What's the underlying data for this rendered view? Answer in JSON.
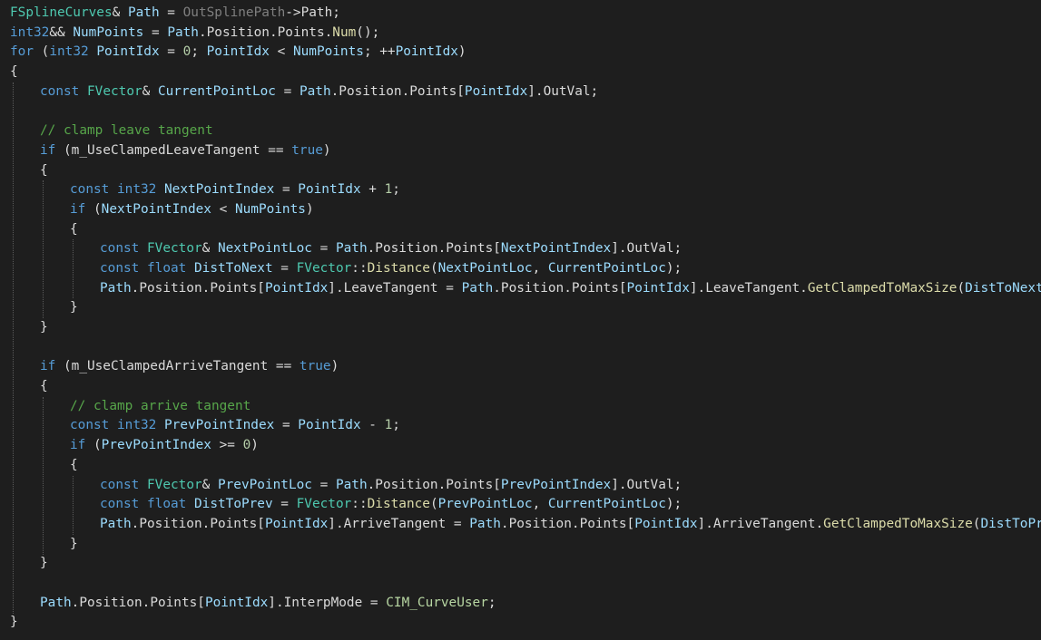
{
  "editor": {
    "colors": {
      "background": "#1e1e1e",
      "default": "#dcdcdc",
      "keyword": "#569cd6",
      "type": "#4ec9b0",
      "identifier": "#9cdcfe",
      "function": "#dcdcaa",
      "number": "#b5cea8",
      "comment": "#57a64a",
      "enum": "#b8d7a3",
      "param": "#7f7f7f"
    },
    "lines": [
      {
        "indent": 0,
        "tokens": [
          [
            "type",
            "FSplineCurves"
          ],
          [
            "default",
            "& "
          ],
          [
            "ident",
            "Path"
          ],
          [
            "default",
            " = "
          ],
          [
            "param",
            "OutSplinePath"
          ],
          [
            "default",
            "->"
          ],
          [
            "member",
            "Path"
          ],
          [
            "default",
            ";"
          ]
        ]
      },
      {
        "indent": 0,
        "tokens": [
          [
            "keyword",
            "int32"
          ],
          [
            "default",
            "&& "
          ],
          [
            "ident",
            "NumPoints"
          ],
          [
            "default",
            " = "
          ],
          [
            "ident",
            "Path"
          ],
          [
            "default",
            "."
          ],
          [
            "member",
            "Position"
          ],
          [
            "default",
            "."
          ],
          [
            "member",
            "Points"
          ],
          [
            "default",
            "."
          ],
          [
            "func",
            "Num"
          ],
          [
            "default",
            "();"
          ]
        ]
      },
      {
        "indent": 0,
        "tokens": [
          [
            "keyword",
            "for"
          ],
          [
            "default",
            " ("
          ],
          [
            "keyword",
            "int32"
          ],
          [
            "default",
            " "
          ],
          [
            "ident",
            "PointIdx"
          ],
          [
            "default",
            " = "
          ],
          [
            "number",
            "0"
          ],
          [
            "default",
            "; "
          ],
          [
            "ident",
            "PointIdx"
          ],
          [
            "default",
            " < "
          ],
          [
            "ident",
            "NumPoints"
          ],
          [
            "default",
            "; ++"
          ],
          [
            "ident",
            "PointIdx"
          ],
          [
            "default",
            ")"
          ]
        ]
      },
      {
        "indent": 0,
        "tokens": [
          [
            "default",
            "{"
          ]
        ]
      },
      {
        "indent": 1,
        "tokens": [
          [
            "keyword",
            "const"
          ],
          [
            "default",
            " "
          ],
          [
            "type",
            "FVector"
          ],
          [
            "default",
            "& "
          ],
          [
            "ident",
            "CurrentPointLoc"
          ],
          [
            "default",
            " = "
          ],
          [
            "ident",
            "Path"
          ],
          [
            "default",
            "."
          ],
          [
            "member",
            "Position"
          ],
          [
            "default",
            "."
          ],
          [
            "member",
            "Points"
          ],
          [
            "default",
            "["
          ],
          [
            "ident",
            "PointIdx"
          ],
          [
            "default",
            "]."
          ],
          [
            "member",
            "OutVal"
          ],
          [
            "default",
            ";"
          ]
        ]
      },
      {
        "indent": 1,
        "tokens": []
      },
      {
        "indent": 1,
        "tokens": [
          [
            "comment",
            "// clamp leave tangent"
          ]
        ]
      },
      {
        "indent": 1,
        "tokens": [
          [
            "keyword",
            "if"
          ],
          [
            "default",
            " ("
          ],
          [
            "member",
            "m_UseClampedLeaveTangent"
          ],
          [
            "default",
            " == "
          ],
          [
            "keyword",
            "true"
          ],
          [
            "default",
            ")"
          ]
        ]
      },
      {
        "indent": 1,
        "tokens": [
          [
            "default",
            "{"
          ]
        ]
      },
      {
        "indent": 2,
        "tokens": [
          [
            "keyword",
            "const"
          ],
          [
            "default",
            " "
          ],
          [
            "keyword",
            "int32"
          ],
          [
            "default",
            " "
          ],
          [
            "ident",
            "NextPointIndex"
          ],
          [
            "default",
            " = "
          ],
          [
            "ident",
            "PointIdx"
          ],
          [
            "default",
            " + "
          ],
          [
            "number",
            "1"
          ],
          [
            "default",
            ";"
          ]
        ]
      },
      {
        "indent": 2,
        "tokens": [
          [
            "keyword",
            "if"
          ],
          [
            "default",
            " ("
          ],
          [
            "ident",
            "NextPointIndex"
          ],
          [
            "default",
            " < "
          ],
          [
            "ident",
            "NumPoints"
          ],
          [
            "default",
            ")"
          ]
        ]
      },
      {
        "indent": 2,
        "tokens": [
          [
            "default",
            "{"
          ]
        ]
      },
      {
        "indent": 3,
        "tokens": [
          [
            "keyword",
            "const"
          ],
          [
            "default",
            " "
          ],
          [
            "type",
            "FVector"
          ],
          [
            "default",
            "& "
          ],
          [
            "ident",
            "NextPointLoc"
          ],
          [
            "default",
            " = "
          ],
          [
            "ident",
            "Path"
          ],
          [
            "default",
            "."
          ],
          [
            "member",
            "Position"
          ],
          [
            "default",
            "."
          ],
          [
            "member",
            "Points"
          ],
          [
            "default",
            "["
          ],
          [
            "ident",
            "NextPointIndex"
          ],
          [
            "default",
            "]."
          ],
          [
            "member",
            "OutVal"
          ],
          [
            "default",
            ";"
          ]
        ]
      },
      {
        "indent": 3,
        "tokens": [
          [
            "keyword",
            "const"
          ],
          [
            "default",
            " "
          ],
          [
            "keyword",
            "float"
          ],
          [
            "default",
            " "
          ],
          [
            "ident",
            "DistToNext"
          ],
          [
            "default",
            " = "
          ],
          [
            "type",
            "FVector"
          ],
          [
            "default",
            "::"
          ],
          [
            "func",
            "Distance"
          ],
          [
            "default",
            "("
          ],
          [
            "ident",
            "NextPointLoc"
          ],
          [
            "default",
            ", "
          ],
          [
            "ident",
            "CurrentPointLoc"
          ],
          [
            "default",
            ");"
          ]
        ]
      },
      {
        "indent": 3,
        "tokens": [
          [
            "ident",
            "Path"
          ],
          [
            "default",
            "."
          ],
          [
            "member",
            "Position"
          ],
          [
            "default",
            "."
          ],
          [
            "member",
            "Points"
          ],
          [
            "default",
            "["
          ],
          [
            "ident",
            "PointIdx"
          ],
          [
            "default",
            "]."
          ],
          [
            "member",
            "LeaveTangent"
          ],
          [
            "default",
            " = "
          ],
          [
            "ident",
            "Path"
          ],
          [
            "default",
            "."
          ],
          [
            "member",
            "Position"
          ],
          [
            "default",
            "."
          ],
          [
            "member",
            "Points"
          ],
          [
            "default",
            "["
          ],
          [
            "ident",
            "PointIdx"
          ],
          [
            "default",
            "]."
          ],
          [
            "member",
            "LeaveTangent"
          ],
          [
            "default",
            "."
          ],
          [
            "func",
            "GetClampedToMaxSize"
          ],
          [
            "default",
            "("
          ],
          [
            "ident",
            "DistToNext"
          ],
          [
            "default",
            ");"
          ]
        ]
      },
      {
        "indent": 2,
        "tokens": [
          [
            "default",
            "}"
          ]
        ]
      },
      {
        "indent": 1,
        "tokens": [
          [
            "default",
            "}"
          ]
        ]
      },
      {
        "indent": 1,
        "tokens": []
      },
      {
        "indent": 1,
        "tokens": [
          [
            "keyword",
            "if"
          ],
          [
            "default",
            " ("
          ],
          [
            "member",
            "m_UseClampedArriveTangent"
          ],
          [
            "default",
            " == "
          ],
          [
            "keyword",
            "true"
          ],
          [
            "default",
            ")"
          ]
        ]
      },
      {
        "indent": 1,
        "tokens": [
          [
            "default",
            "{"
          ]
        ]
      },
      {
        "indent": 2,
        "tokens": [
          [
            "comment",
            "// clamp arrive tangent"
          ]
        ]
      },
      {
        "indent": 2,
        "tokens": [
          [
            "keyword",
            "const"
          ],
          [
            "default",
            " "
          ],
          [
            "keyword",
            "int32"
          ],
          [
            "default",
            " "
          ],
          [
            "ident",
            "PrevPointIndex"
          ],
          [
            "default",
            " = "
          ],
          [
            "ident",
            "PointIdx"
          ],
          [
            "default",
            " - "
          ],
          [
            "number",
            "1"
          ],
          [
            "default",
            ";"
          ]
        ]
      },
      {
        "indent": 2,
        "tokens": [
          [
            "keyword",
            "if"
          ],
          [
            "default",
            " ("
          ],
          [
            "ident",
            "PrevPointIndex"
          ],
          [
            "default",
            " >= "
          ],
          [
            "number",
            "0"
          ],
          [
            "default",
            ")"
          ]
        ]
      },
      {
        "indent": 2,
        "tokens": [
          [
            "default",
            "{"
          ]
        ]
      },
      {
        "indent": 3,
        "tokens": [
          [
            "keyword",
            "const"
          ],
          [
            "default",
            " "
          ],
          [
            "type",
            "FVector"
          ],
          [
            "default",
            "& "
          ],
          [
            "ident",
            "PrevPointLoc"
          ],
          [
            "default",
            " = "
          ],
          [
            "ident",
            "Path"
          ],
          [
            "default",
            "."
          ],
          [
            "member",
            "Position"
          ],
          [
            "default",
            "."
          ],
          [
            "member",
            "Points"
          ],
          [
            "default",
            "["
          ],
          [
            "ident",
            "PrevPointIndex"
          ],
          [
            "default",
            "]."
          ],
          [
            "member",
            "OutVal"
          ],
          [
            "default",
            ";"
          ]
        ]
      },
      {
        "indent": 3,
        "tokens": [
          [
            "keyword",
            "const"
          ],
          [
            "default",
            " "
          ],
          [
            "keyword",
            "float"
          ],
          [
            "default",
            " "
          ],
          [
            "ident",
            "DistToPrev"
          ],
          [
            "default",
            " = "
          ],
          [
            "type",
            "FVector"
          ],
          [
            "default",
            "::"
          ],
          [
            "func",
            "Distance"
          ],
          [
            "default",
            "("
          ],
          [
            "ident",
            "PrevPointLoc"
          ],
          [
            "default",
            ", "
          ],
          [
            "ident",
            "CurrentPointLoc"
          ],
          [
            "default",
            ");"
          ]
        ]
      },
      {
        "indent": 3,
        "tokens": [
          [
            "ident",
            "Path"
          ],
          [
            "default",
            "."
          ],
          [
            "member",
            "Position"
          ],
          [
            "default",
            "."
          ],
          [
            "member",
            "Points"
          ],
          [
            "default",
            "["
          ],
          [
            "ident",
            "PointIdx"
          ],
          [
            "default",
            "]."
          ],
          [
            "member",
            "ArriveTangent"
          ],
          [
            "default",
            " = "
          ],
          [
            "ident",
            "Path"
          ],
          [
            "default",
            "."
          ],
          [
            "member",
            "Position"
          ],
          [
            "default",
            "."
          ],
          [
            "member",
            "Points"
          ],
          [
            "default",
            "["
          ],
          [
            "ident",
            "PointIdx"
          ],
          [
            "default",
            "]."
          ],
          [
            "member",
            "ArriveTangent"
          ],
          [
            "default",
            "."
          ],
          [
            "func",
            "GetClampedToMaxSize"
          ],
          [
            "default",
            "("
          ],
          [
            "ident",
            "DistToPrev"
          ],
          [
            "default",
            ");"
          ]
        ]
      },
      {
        "indent": 2,
        "tokens": [
          [
            "default",
            "}"
          ]
        ]
      },
      {
        "indent": 1,
        "tokens": [
          [
            "default",
            "}"
          ]
        ]
      },
      {
        "indent": 1,
        "tokens": []
      },
      {
        "indent": 1,
        "tokens": [
          [
            "ident",
            "Path"
          ],
          [
            "default",
            "."
          ],
          [
            "member",
            "Position"
          ],
          [
            "default",
            "."
          ],
          [
            "member",
            "Points"
          ],
          [
            "default",
            "["
          ],
          [
            "ident",
            "PointIdx"
          ],
          [
            "default",
            "]."
          ],
          [
            "member",
            "InterpMode"
          ],
          [
            "default",
            " = "
          ],
          [
            "enum",
            "CIM_CurveUser"
          ],
          [
            "default",
            ";"
          ]
        ]
      },
      {
        "indent": 0,
        "tokens": [
          [
            "default",
            "}"
          ]
        ]
      }
    ]
  }
}
